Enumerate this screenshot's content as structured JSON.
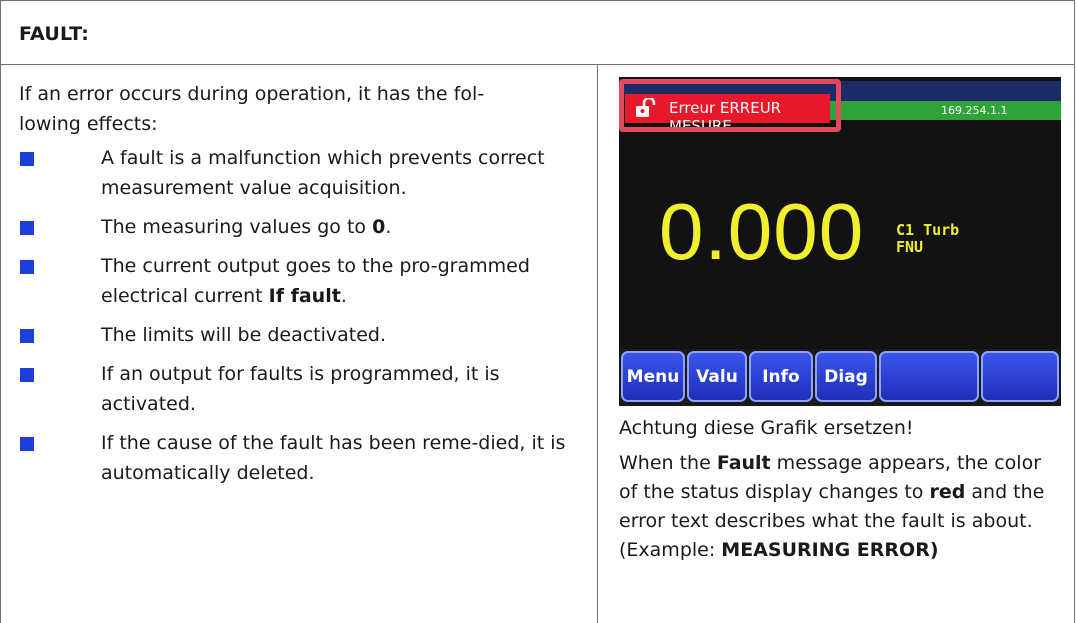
{
  "header": {
    "title": "FAULT:"
  },
  "left": {
    "intro": "If an error occurs during operation, it has the fol-\nlowing effects:",
    "bullets": [
      {
        "text": "A fault is a malfunction which prevents correct measurement value acquisition."
      },
      {
        "pre": "The measuring values go to ",
        "bold": "0",
        "post": "."
      },
      {
        "pre": "The current output goes to the pro-grammed electrical current ",
        "bold": "If fault",
        "post": "."
      },
      {
        "text": "The limits will be deactivated."
      },
      {
        "text": "If an output for faults is programmed, it is activated."
      },
      {
        "text": "If the cause of the fault has been reme-died, it is automatically deleted."
      }
    ]
  },
  "screen": {
    "error_text": "Erreur ERREUR MESURE",
    "ip_text": "169.254.1.1",
    "value": "0.000",
    "unit_line1": "C1 Turb",
    "unit_line2": "FNU",
    "buttons": [
      "Menu",
      "Valu",
      "Info",
      "Diag",
      "",
      ""
    ]
  },
  "caption": {
    "warning": "Achtung diese Grafik ersetzen!",
    "p1": "When the ",
    "p1_bold": "Fault",
    "p2": " message appears, the color of the status display changes to ",
    "p2_bold": "red",
    "p3": " and the error text describes what the fault is about.",
    "example_pre": "(Example: ",
    "example_bold": "MEASURING ERROR)"
  },
  "colors": {
    "bullet": "#1b3fd8",
    "error_bar": "#e8172a",
    "value": "#f1ee2b"
  }
}
